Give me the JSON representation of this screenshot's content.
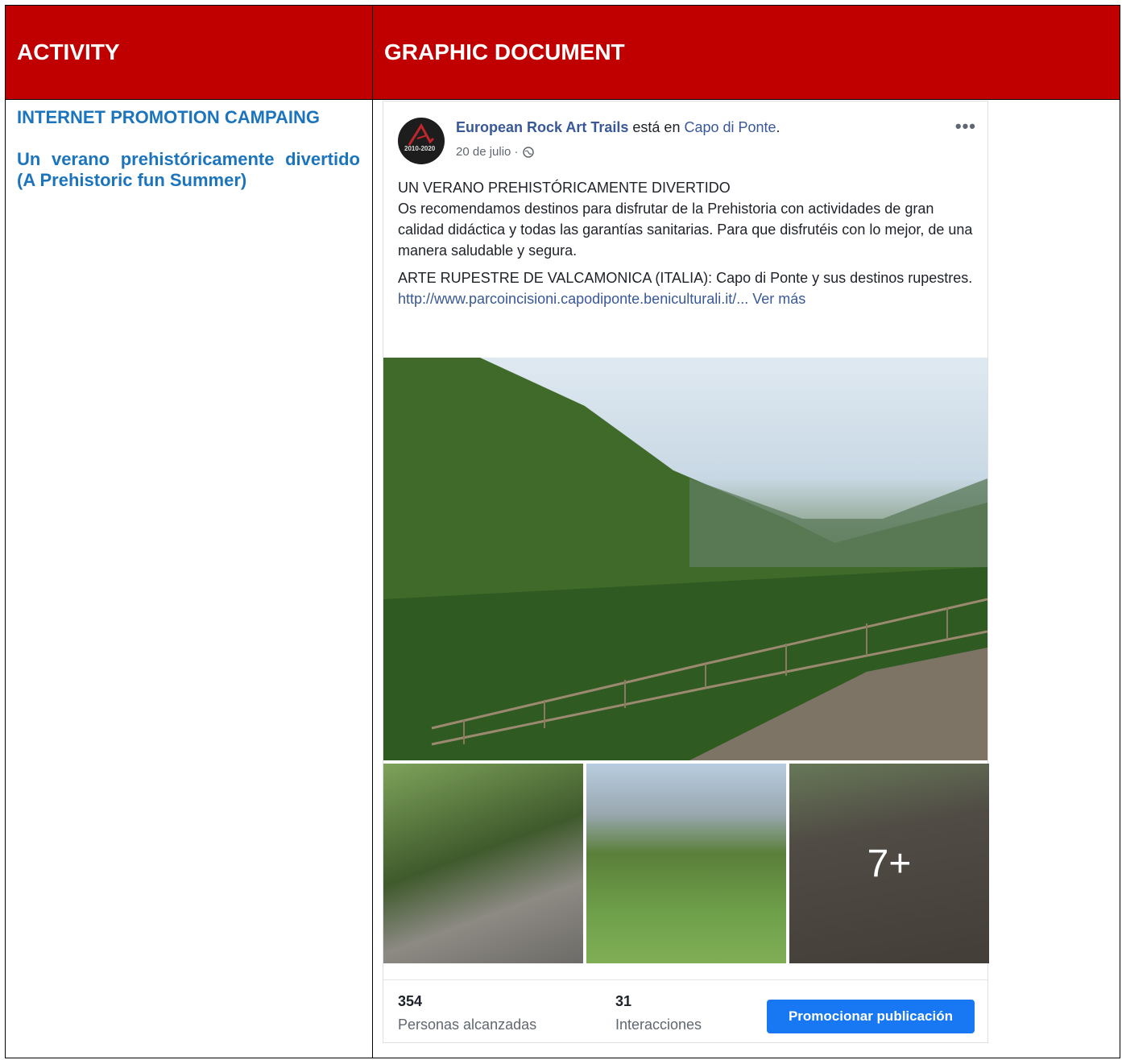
{
  "table": {
    "header": {
      "activity": "ACTIVITY",
      "graphic": "GRAPHIC DOCUMENT"
    },
    "activity": {
      "title": "INTERNET PROMOTION CAMPAING",
      "subtitle": "Un verano prehistóricamente divertido (A Prehistoric fun Summer)"
    }
  },
  "post": {
    "avatar_text": "2010-2020",
    "page_name": "European Rock Art Trails",
    "at_text": " está en ",
    "place": "Capo di Ponte",
    "place_end": ".",
    "date": "20 de julio ·",
    "more_icon": "more-options-icon",
    "body": {
      "line1": "UN VERANO PREHISTÓRICAMENTE DIVERTIDO",
      "line2": "Os recomendamos destinos para disfrutar de la Prehistoria con actividades de gran calidad didáctica y todas las garantías sanitarias. Para que disfrutéis con lo mejor, de una manera saludable y segura.",
      "line3": "ARTE RUPESTRE DE VALCAMONICA (ITALIA): Capo di Ponte y sus destinos rupestres.",
      "link": "http://www.parcoincisioni.capodiponte.beniculturali.it/...",
      "see_more": " Ver más"
    },
    "more_photos": "7+",
    "stats": {
      "reach_value": "354",
      "reach_label": "Personas alcanzadas",
      "interactions_value": "31",
      "interactions_label": "Interacciones"
    },
    "promote_button": "Promocionar publicación"
  }
}
